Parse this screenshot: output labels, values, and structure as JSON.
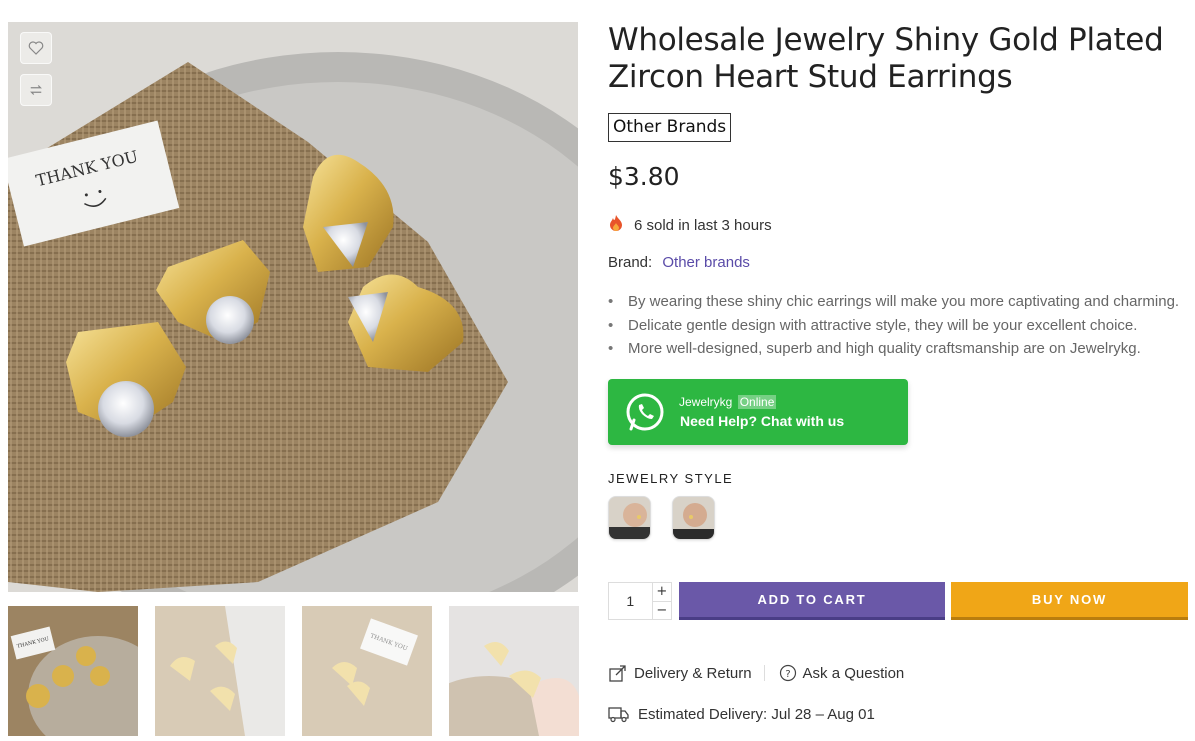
{
  "gallery": {
    "main_alt": "Gold heart stud earrings on burlap with thank you card",
    "card_text": "THANK YOU",
    "thumbnails": [
      {
        "name": "thumb-1",
        "card_text": "THANK YOU"
      },
      {
        "name": "thumb-2"
      },
      {
        "name": "thumb-3",
        "card_text": "THANK YOU"
      },
      {
        "name": "thumb-4"
      }
    ]
  },
  "product": {
    "title": "Wholesale Jewelry Shiny Gold Plated Zircon Heart Stud Earrings",
    "brand_badge": "Other Brands",
    "price": "$3.80",
    "sold_text": "6 sold in last 3 hours",
    "brand_label": "Brand:",
    "brand_value": "Other brands",
    "bullets": [
      "By wearing these shiny chic earrings will make you more captivating and charming.",
      "Delicate gentle design with attractive style, they will be your excellent choice.",
      "More well-designed, superb and high quality craftsmanship are on Jewelrykg."
    ]
  },
  "whatsapp": {
    "name": "Jewelrykg",
    "status": "Online",
    "cta": "Need Help? Chat with us"
  },
  "style": {
    "label": "JEWELRY STYLE"
  },
  "purchase": {
    "quantity": "1",
    "plus": "+",
    "minus": "−",
    "add_to_cart": "ADD TO CART",
    "buy_now": "BUY NOW"
  },
  "links": {
    "delivery_return": "Delivery & Return",
    "ask_question": "Ask a Question",
    "estimated_delivery": "Estimated Delivery: Jul 28 – Aug 01"
  },
  "colors": {
    "accent": "#6a58a8",
    "buy": "#f0a617",
    "whatsapp": "#2db742",
    "brand_link": "#5a4ba8"
  }
}
